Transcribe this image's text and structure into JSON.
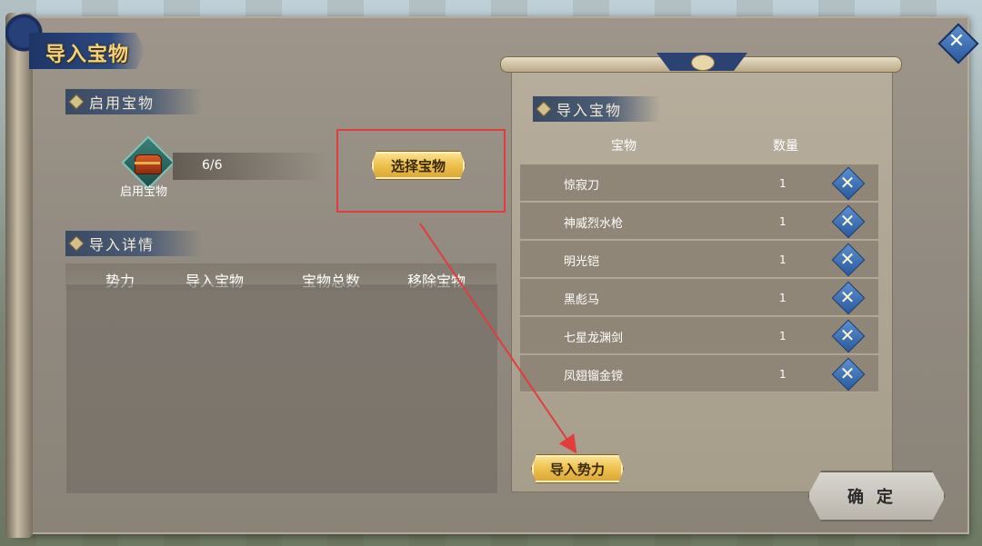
{
  "window": {
    "title": "导入宝物"
  },
  "left": {
    "enabled_section": {
      "title": "启用宝物",
      "chest_label": "启用宝物",
      "count": "6/6"
    },
    "select_button": "选择宝物",
    "details_section": {
      "title": "导入详情",
      "columns": [
        "势力",
        "导入宝物",
        "宝物总数",
        "移除宝物"
      ]
    }
  },
  "right": {
    "section_title": "导入宝物",
    "columns": {
      "item": "宝物",
      "qty": "数量"
    },
    "rows": [
      {
        "name": "惊寂刀",
        "qty": "1"
      },
      {
        "name": "神威烈水枪",
        "qty": "1"
      },
      {
        "name": "明光铠",
        "qty": "1"
      },
      {
        "name": "黑彪马",
        "qty": "1"
      },
      {
        "name": "七星龙渊剑",
        "qty": "1"
      },
      {
        "name": "凤翅镏金镋",
        "qty": "1"
      }
    ],
    "import_button": "导入势力"
  },
  "confirm_button": "确定",
  "colors": {
    "highlight": "#e23c3c",
    "gold": "#f0c451",
    "blue": "#2a5aa0"
  }
}
